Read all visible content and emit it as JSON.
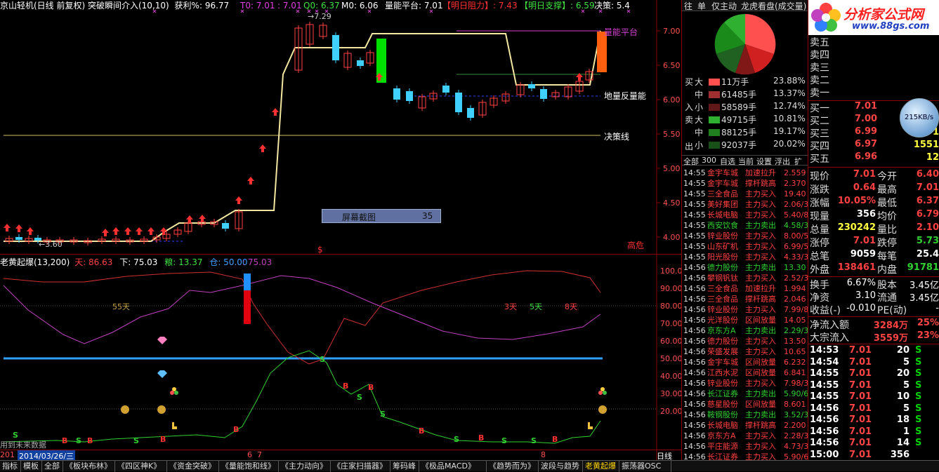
{
  "window": {
    "title": "京山轻机(日线 前复权) 突破瞬间介入(10,10)"
  },
  "upper": {
    "header": {
      "title": "京山轻机(日线 前复权) 突破瞬间介入(10,10)",
      "profit_label": "获利%:",
      "profit_value": "96.77",
      "t0": "T0: 7.01",
      "t01": ": 7.01",
      "q0": "Q0: 6.37",
      "m0": "M0: 6.06",
      "lnpt": "量能平台: 7.01",
      "mrzl_label": "【明日阻力】",
      "mrzl_value": ": 7.43",
      "mrzc_label": "【明日支撑】",
      "mrzc_value": ": 6.59",
      "jc": "决策: 5.4"
    },
    "price_axis": [
      "7.00",
      "6.50",
      "6.00",
      "5.50",
      "5.00",
      "4.50",
      "4.00"
    ],
    "annotations": {
      "lnpt": "量能平台",
      "dlfln": "地量反量能",
      "jcx": "决策线",
      "high_label": "→7.29",
      "low_label": "←3.60",
      "gaowei": "高危",
      "dollar": "$",
      "ss_label": "屏幕截图",
      "ss_value": "35"
    }
  },
  "lower": {
    "header": {
      "title": "老黄起爆(13,200)",
      "tian": "天: 86.63",
      "xia": "下: 75.03",
      "liang": "粮: 13.37",
      "cang": "仓: 50.00",
      "val": ": 75.03"
    },
    "axis": [
      "100.0",
      "90.00",
      "80.00",
      "70.00",
      "60.00",
      "50.00",
      "40.00",
      "30.00",
      "20.00"
    ],
    "labels": {
      "d55": "55天",
      "d3": "3天",
      "d5": "5天",
      "d8": "8天",
      "future": "用到未来数据"
    }
  },
  "date_axis": {
    "left": "201",
    "date": "2014/03/26/三",
    "m6": "6",
    "m7": "7",
    "m8": "8",
    "period": "日线"
  },
  "side": {
    "tabs": [
      "往",
      "单",
      "仅主动",
      "龙虎看盘(成交量)"
    ],
    "buy_title": "买",
    "buy_in": "入",
    "sell_title": "卖",
    "sell_out": "出",
    "flows": [
      {
        "size": "大",
        "amount": "11万手",
        "pct": "23.88%"
      },
      {
        "size": "中",
        "amount": "61485手",
        "pct": "13.37%"
      },
      {
        "size": "小",
        "amount": "58589手",
        "pct": "12.74%"
      },
      {
        "size": "大",
        "amount": "49715手",
        "pct": "10.81%"
      },
      {
        "size": "中",
        "amount": "88125手",
        "pct": "19.17%"
      },
      {
        "size": "小",
        "amount": "92037手",
        "pct": "20.02%"
      }
    ],
    "filter": [
      "全部",
      "300",
      "自选",
      "当前",
      "设置",
      "浮出",
      "扩"
    ],
    "ticks": [
      {
        "t": "14:55",
        "n": "金宇车城",
        "a": "加速拉升",
        "v": "2.559"
      },
      {
        "t": "14:55",
        "n": "金宇车城",
        "a": "撑杆跳高",
        "v": "2.370"
      },
      {
        "t": "14:55",
        "n": "三全食品",
        "a": "主力买入",
        "v": "19.40"
      },
      {
        "t": "14:55",
        "n": "美好集团",
        "a": "主力买入",
        "v": "2.06/3"
      },
      {
        "t": "14:55",
        "n": "长城电脑",
        "a": "主力买入",
        "v": "5.40/8"
      },
      {
        "t": "14:55",
        "n": "西安饮食",
        "a": "主力卖出",
        "v": "4.58/3"
      },
      {
        "t": "14:55",
        "n": "锌业股份",
        "a": "主力买入",
        "v": "8.00/5"
      },
      {
        "t": "14:55",
        "n": "山东矿机",
        "a": "主力买入",
        "v": "6.99/5"
      },
      {
        "t": "14:55",
        "n": "阳光股份",
        "a": "主力买入",
        "v": "4.33/3"
      },
      {
        "t": "14:56",
        "n": "德力股份",
        "a": "主力卖出",
        "v": "13.30"
      },
      {
        "t": "14:56",
        "n": "攀钢钒钛",
        "a": "主力买入",
        "v": "2.52/3"
      },
      {
        "t": "14:56",
        "n": "三全食品",
        "a": "加速拉升",
        "v": "1.994"
      },
      {
        "t": "14:56",
        "n": "三全食品",
        "a": "撑杆跳高",
        "v": "2.046"
      },
      {
        "t": "14:56",
        "n": "锌业股份",
        "a": "主力买入",
        "v": "7.99/8"
      },
      {
        "t": "14:56",
        "n": "光洋股份",
        "a": "区间放量",
        "v": "14.05"
      },
      {
        "t": "14:56",
        "n": "京东方A",
        "a": "主力卖出",
        "v": "2.29/3"
      },
      {
        "t": "14:56",
        "n": "德力股份",
        "a": "主力买入",
        "v": "13.50"
      },
      {
        "t": "14:56",
        "n": "荣盛发展",
        "a": "主力买入",
        "v": "10.65"
      },
      {
        "t": "14:56",
        "n": "金宇车城",
        "a": "区间放量",
        "v": "6.232"
      },
      {
        "t": "14:56",
        "n": "江西水泥",
        "a": "区间放量",
        "v": "6.841"
      },
      {
        "t": "14:56",
        "n": "锌业股份",
        "a": "主力买入",
        "v": "7.98/3"
      },
      {
        "t": "14:56",
        "n": "长江证券",
        "a": "主力卖出",
        "v": "5.90/6"
      },
      {
        "t": "14:56",
        "n": "慈星股份",
        "a": "区间放量",
        "v": "8.601"
      },
      {
        "t": "14:56",
        "n": "鞍钢股份",
        "a": "主力卖出",
        "v": "3.52/3"
      },
      {
        "t": "14:56",
        "n": "长城电脑",
        "a": "撑杆跳高",
        "v": "2.200"
      },
      {
        "t": "14:56",
        "n": "京东方A",
        "a": "主力买入",
        "v": "2.28/3"
      },
      {
        "t": "14:56",
        "n": "平庄能源",
        "a": "主力买入",
        "v": "4.73/3"
      },
      {
        "t": "14:56",
        "n": "长江证券",
        "a": "主力买入",
        "v": "5.90/6"
      }
    ]
  },
  "quote": {
    "logo": "分析家公式网",
    "site": "www.88gs.com",
    "asks": [
      {
        "l": "卖五"
      },
      {
        "l": "卖四"
      },
      {
        "l": "卖三"
      },
      {
        "l": "卖二"
      },
      {
        "l": "卖一"
      }
    ],
    "bids": [
      {
        "l": "买一",
        "p": "7.01",
        "v": ""
      },
      {
        "l": "买二",
        "p": "7.00",
        "v": ""
      },
      {
        "l": "买三",
        "p": "6.99",
        "v": "1"
      },
      {
        "l": "买四",
        "p": "6.97",
        "v": "1551"
      },
      {
        "l": "买五",
        "p": "6.96",
        "v": "12"
      }
    ],
    "speed": "215KB/s",
    "stats": [
      {
        "a": "现价",
        "b": "7.01",
        "c": "今开",
        "d": "6.40"
      },
      {
        "a": "涨跌",
        "b": "0.64",
        "c": "最高",
        "d": "7.01"
      },
      {
        "a": "涨幅",
        "b": "10.05%",
        "c": "最低",
        "d": "6.37"
      },
      {
        "a": "现量",
        "b": "356",
        "c": "均价",
        "d": "6.79"
      },
      {
        "a": "总量",
        "b": "230242",
        "c": "量比",
        "d": "2.10"
      },
      {
        "a": "涨停",
        "b": "7.01",
        "c": "跌停",
        "d": "5.73"
      },
      {
        "a": "总笔",
        "b": "9059",
        "c": "每笔",
        "d": "25.4"
      },
      {
        "a": "外盘",
        "b": "138461",
        "c": "内盘",
        "d": "91781"
      }
    ],
    "stats2": [
      {
        "a": "换手",
        "b": "6.67%",
        "c": "股本",
        "d": "3.45亿"
      },
      {
        "a": "净资",
        "b": "3.10",
        "c": "流通",
        "d": "3.45亿"
      },
      {
        "a": "收益(-)",
        "b": "-0.010",
        "c": "PE(动)",
        "d": "-"
      }
    ],
    "netflow": [
      {
        "a": "净流入额",
        "b": "3284万",
        "c": "25%"
      },
      {
        "a": "大宗流入",
        "b": "3559万",
        "c": "23%"
      }
    ],
    "trades": [
      {
        "t": "14:53",
        "p": "7.01",
        "v": "20",
        "s": "S"
      },
      {
        "t": "14:54",
        "p": "7.01",
        "v": "5",
        "s": "S"
      },
      {
        "t": "14:55",
        "p": "7.01",
        "v": "20",
        "s": "S"
      },
      {
        "t": "14:55",
        "p": "7.01",
        "v": "5",
        "s": "S"
      },
      {
        "t": "14:55",
        "p": "7.01",
        "v": "10",
        "s": "S"
      },
      {
        "t": "14:56",
        "p": "7.01",
        "v": "5",
        "s": "S"
      },
      {
        "t": "14:56",
        "p": "7.01",
        "v": "18",
        "s": "S"
      },
      {
        "t": "14:56",
        "p": "7.01",
        "v": "1",
        "s": "S"
      },
      {
        "t": "14:56",
        "p": "7.01",
        "v": "14",
        "s": "S"
      },
      {
        "t": "15:00",
        "p": "7.01",
        "v": "356",
        "s": ""
      }
    ]
  },
  "bottom_tabs": [
    "指标",
    "模板",
    "全部",
    "《板块布林》",
    "《四区神K》",
    "《资金突破》",
    "《量能饱和线》",
    "《主力动向》",
    "《庄家扫描器》",
    "筹码峰",
    "《极品MACD》",
    "《趋势而为》",
    "波段与趋势",
    "老黄起爆",
    "振荡器OSC"
  ]
}
